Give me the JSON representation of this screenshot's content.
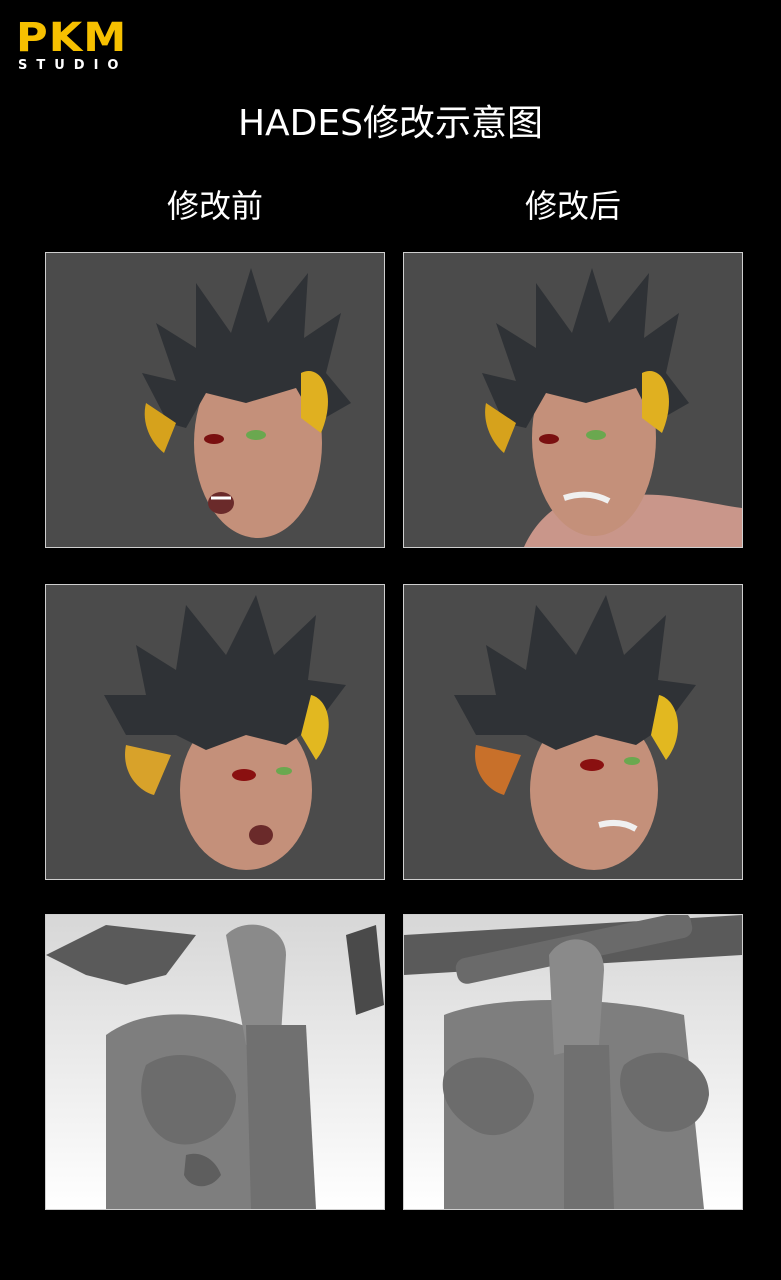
{
  "logo": {
    "main": "PKM",
    "sub": "STUDIO"
  },
  "title": "HADES修改示意图",
  "columns": {
    "before": "修改前",
    "after": "修改后"
  },
  "colors": {
    "logo_yellow": "#f6c000",
    "panel_gray": "#4b4b4b",
    "background": "#000000"
  }
}
